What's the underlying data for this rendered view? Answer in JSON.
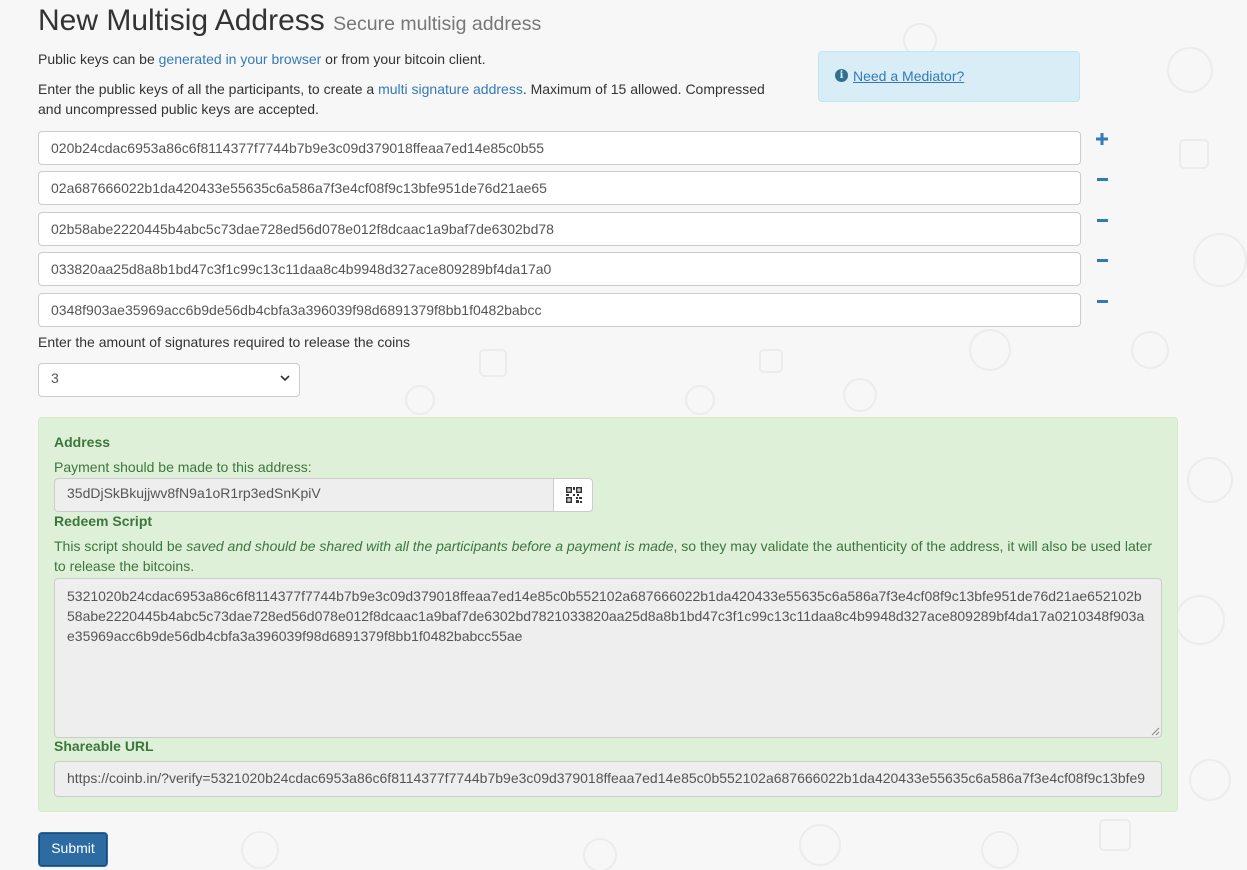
{
  "header": {
    "title": "New Multisig Address",
    "subtitle": "Secure multisig address"
  },
  "intro": {
    "line1_pre": "Public keys can be ",
    "line1_link": "generated in your browser",
    "line1_post": " or from your bitcoin client.",
    "line2_pre": "Enter the public keys of all the participants, to create a ",
    "line2_link": "multi signature address",
    "line2_post": ". Maximum of 15 allowed. Compressed",
    "line3": "and uncompressed public keys are accepted."
  },
  "mediator": {
    "icon": "info-circle-icon",
    "label": "Need a Mediator?"
  },
  "public_keys": [
    "020b24cdac6953a86c6f8114377f7744b7b9e3c09d379018ffeaa7ed14e85c0b55",
    "02a687666022b1da420433e55635c6a586a7f3e4cf08f9c13bfe951de76d21ae65",
    "02b58abe2220445b4abc5c73dae728ed56d078e012f8dcaac1a9baf7de6302bd78",
    "033820aa25d8a8b1bd47c3f1c99c13c11daa8c4b9948d327ace809289bf4da17a0",
    "0348f903ae35969acc6b9de56db4cbfa3a396039f98d6891379f8bb1f0482babcc"
  ],
  "key_buttons": [
    "+",
    "-",
    "-",
    "-",
    "-"
  ],
  "signatures": {
    "label": "Enter the amount of signatures required to release the coins",
    "selected": "3"
  },
  "result": {
    "address_heading": "Address",
    "address_note": "Payment should be made to this address:",
    "address_value": "35dDjSkBkujjwv8fN9a1oR1rp3edSnKpiV",
    "qr_icon": "qr-code-icon",
    "redeem_heading": "Redeem Script",
    "redeem_note_pre": "This script should be ",
    "redeem_note_em": "saved and should be shared with all the participants before a payment is made",
    "redeem_note_post": ", so they may validate the authenticity of the address, it will also be used later",
    "redeem_note_line2": "to release the bitcoins.",
    "redeem_value": "5321020b24cdac6953a86c6f8114377f7744b7b9e3c09d379018ffeaa7ed14e85c0b552102a687666022b1da420433e55635c6a586a7f3e4cf08f9c13bfe951de76d21ae652102b58abe2220445b4abc5c73dae728ed56d078e012f8dcaac1a9baf7de6302bd7821033820aa25d8a8b1bd47c3f1c99c13c11daa8c4b9948d327ace809289bf4da17a0210348f903ae35969acc6b9de56db4cbfa3a396039f98d6891379f8bb1f0482babcc55ae",
    "url_heading": "Shareable URL",
    "url_value": "https://coinb.in/?verify=5321020b24cdac6953a86c6f8114377f7744b7b9e3c09d379018ffeaa7ed14e85c0b552102a687666022b1da420433e55635c6a586a7f3e4cf08f9c13bfe9"
  },
  "submit_label": "Submit",
  "colors": {
    "link": "#337ab7",
    "success_bg": "#dff0d8",
    "success_text": "#3c763d",
    "info_bg": "#d9edf7",
    "primary": "#2d6ca2"
  }
}
